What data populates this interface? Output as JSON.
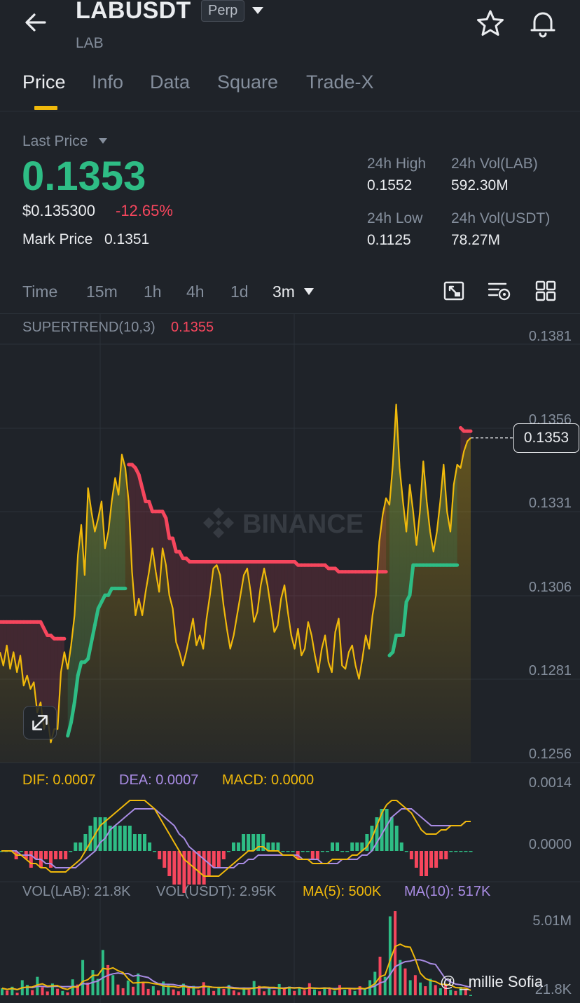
{
  "header": {
    "symbol": "LABUSDT",
    "contract_type": "Perp",
    "base_asset": "LAB",
    "icons": [
      "back-arrow-icon",
      "chevron-down-icon",
      "star-icon",
      "bell-icon"
    ]
  },
  "tabs": [
    {
      "label": "Price",
      "active": true
    },
    {
      "label": "Info",
      "active": false
    },
    {
      "label": "Data",
      "active": false
    },
    {
      "label": "Square",
      "active": false
    },
    {
      "label": "Trade-X",
      "active": false
    }
  ],
  "price": {
    "last_label": "Last Price",
    "last": "0.1353",
    "usd": "$0.135300",
    "change": "-12.65%",
    "mark_label": "Mark Price",
    "mark": "0.1351"
  },
  "stats": {
    "high_label": "24h High",
    "high": "0.1552",
    "vol_base_label": "24h Vol(LAB)",
    "vol_base": "592.30M",
    "low_label": "24h Low",
    "low": "0.1125",
    "vol_quote_label": "24h Vol(USDT)",
    "vol_quote": "78.27M"
  },
  "intervals": [
    {
      "label": "Time",
      "active": false
    },
    {
      "label": "15m",
      "active": false
    },
    {
      "label": "1h",
      "active": false
    },
    {
      "label": "4h",
      "active": false
    },
    {
      "label": "1d",
      "active": false
    },
    {
      "label": "3m",
      "active": true
    }
  ],
  "colors": {
    "up": "#2ebd85",
    "down": "#f6465d",
    "accent": "#f0b90b",
    "ma10": "#a98ce4",
    "background": "#1f2329"
  },
  "chart_data": [
    {
      "type": "line",
      "indicator_label": "SUPERTREND(10,3)",
      "indicator_value": "0.1355",
      "y_ticks": [
        "0.1381",
        "0.1356",
        "0.1331",
        "0.1306",
        "0.1281",
        "0.1256"
      ],
      "ylim": [
        0.1256,
        0.1381
      ],
      "current_price": "0.1353",
      "watermark": "BINANCE",
      "grid": true,
      "price": [
        0.1289,
        0.1285,
        0.1291,
        0.1284,
        0.1289,
        0.1283,
        0.1288,
        0.1279,
        0.1282,
        0.1278,
        0.128,
        0.1271,
        0.1274,
        0.1266,
        0.127,
        0.1262,
        0.1266,
        0.1266,
        0.1283,
        0.1289,
        0.1284,
        0.1291,
        0.13,
        0.1318,
        0.1327,
        0.1312,
        0.1338,
        0.1331,
        0.1325,
        0.1329,
        0.1334,
        0.132,
        0.1325,
        0.1334,
        0.1341,
        0.1336,
        0.1348,
        0.1344,
        0.1334,
        0.1313,
        0.13,
        0.1305,
        0.13,
        0.1307,
        0.1313,
        0.132,
        0.1313,
        0.1307,
        0.132,
        0.1315,
        0.1306,
        0.1302,
        0.1292,
        0.1289,
        0.1285,
        0.1289,
        0.1294,
        0.1299,
        0.1291,
        0.1294,
        0.129,
        0.1299,
        0.1306,
        0.1314,
        0.1315,
        0.1312,
        0.1303,
        0.1296,
        0.129,
        0.1294,
        0.13,
        0.1306,
        0.1312,
        0.1314,
        0.1307,
        0.1298,
        0.1301,
        0.1309,
        0.1314,
        0.1309,
        0.1302,
        0.1295,
        0.1297,
        0.1305,
        0.1309,
        0.1301,
        0.1294,
        0.129,
        0.1296,
        0.1288,
        0.129,
        0.1298,
        0.1294,
        0.1288,
        0.1283,
        0.129,
        0.1294,
        0.1286,
        0.1283,
        0.1295,
        0.1299,
        0.1285,
        0.1284,
        0.1289,
        0.1291,
        0.1285,
        0.1281,
        0.1287,
        0.1294,
        0.129,
        0.13,
        0.1306,
        0.1322,
        0.133,
        0.1335,
        0.1333,
        0.1345,
        0.1363,
        0.1344,
        0.1334,
        0.1325,
        0.1339,
        0.1331,
        0.1321,
        0.1331,
        0.1346,
        0.1334,
        0.1325,
        0.1319,
        0.1325,
        0.1334,
        0.1345,
        0.1331,
        0.1325,
        0.1339,
        0.1345,
        0.1344,
        0.1349,
        0.1352,
        0.1353
      ],
      "supertrend": [
        0.1298,
        0.1298,
        0.1298,
        0.1298,
        0.1298,
        0.1298,
        0.1298,
        0.1298,
        0.1298,
        0.1298,
        0.1298,
        0.1298,
        0.1298,
        0.1296,
        0.1294,
        0.1294,
        0.1293,
        0.1293,
        0.1293,
        0.1293,
        0.1264,
        0.1268,
        0.1274,
        0.1282,
        0.1286,
        0.1286,
        0.1287,
        0.1292,
        0.1297,
        0.1302,
        0.1304,
        0.1306,
        0.1306,
        0.1308,
        0.1308,
        0.1308,
        0.1308,
        0.1308,
        0.1345,
        0.1345,
        0.1344,
        0.1342,
        0.1338,
        0.1334,
        0.1334,
        0.1331,
        0.1331,
        0.1331,
        0.1331,
        0.1329,
        0.1323,
        0.1323,
        0.1319,
        0.1319,
        0.1317,
        0.1317,
        0.1316,
        0.1316,
        0.1316,
        0.1316,
        0.1316,
        0.1316,
        0.1316,
        0.1316,
        0.1316,
        0.1316,
        0.1316,
        0.1316,
        0.1316,
        0.1316,
        0.1316,
        0.1316,
        0.1316,
        0.1316,
        0.1316,
        0.1316,
        0.1316,
        0.1316,
        0.1316,
        0.1316,
        0.1316,
        0.1316,
        0.1316,
        0.1316,
        0.1316,
        0.1316,
        0.1316,
        0.1316,
        0.1315,
        0.1315,
        0.1315,
        0.1315,
        0.1315,
        0.1315,
        0.1315,
        0.1315,
        0.1315,
        0.1314,
        0.1314,
        0.1314,
        0.1313,
        0.1313,
        0.1313,
        0.1313,
        0.1313,
        0.1313,
        0.1313,
        0.1313,
        0.1313,
        0.1313,
        0.1313,
        0.1313,
        0.1313,
        0.1313,
        0.1313,
        0.1288,
        0.1289,
        0.1294,
        0.1294,
        0.1294,
        0.1304,
        0.1306,
        0.1315,
        0.1315,
        0.1315,
        0.1315,
        0.1315,
        0.1315,
        0.1315,
        0.1315,
        0.1315,
        0.1315,
        0.1315,
        0.1315,
        0.1315,
        0.1315,
        0.1356,
        0.1355,
        0.1355,
        0.1355,
        0.1355
      ],
      "supertrend_trend": [
        "down",
        "down",
        "down",
        "down",
        "down",
        "down",
        "down",
        "down",
        "down",
        "down",
        "down",
        "down",
        "down",
        "down",
        "down",
        "down",
        "down",
        "down",
        "down",
        "down",
        "up",
        "up",
        "up",
        "up",
        "up",
        "up",
        "up",
        "up",
        "up",
        "up",
        "up",
        "up",
        "up",
        "up",
        "up",
        "up",
        "up",
        "up",
        "down",
        "down",
        "down",
        "down",
        "down",
        "down",
        "down",
        "down",
        "down",
        "down",
        "down",
        "down",
        "down",
        "down",
        "down",
        "down",
        "down",
        "down",
        "down",
        "down",
        "down",
        "down",
        "down",
        "down",
        "down",
        "down",
        "down",
        "down",
        "down",
        "down",
        "down",
        "down",
        "down",
        "down",
        "down",
        "down",
        "down",
        "down",
        "down",
        "down",
        "down",
        "down",
        "down",
        "down",
        "down",
        "down",
        "down",
        "down",
        "down",
        "down",
        "down",
        "down",
        "down",
        "down",
        "down",
        "down",
        "down",
        "down",
        "down",
        "down",
        "down",
        "down",
        "down",
        "down",
        "down",
        "down",
        "down",
        "down",
        "down",
        "down",
        "down",
        "down",
        "down",
        "down",
        "down",
        "down",
        "down",
        "up",
        "up",
        "up",
        "up",
        "up",
        "up",
        "up",
        "up",
        "up",
        "up",
        "up",
        "up",
        "up",
        "up",
        "up",
        "up",
        "up",
        "up",
        "up",
        "up",
        "up",
        "down",
        "down",
        "down",
        "down",
        "down"
      ]
    },
    {
      "type": "bar",
      "indicator": "MACD",
      "dif_label": "DIF: 0.0007",
      "dea_label": "DEA: 0.0007",
      "macd_label": "MACD: 0.0000",
      "y_ticks": [
        "0.0014",
        "0.0000"
      ],
      "ylim": [
        -0.0008,
        0.0016
      ],
      "dif": [
        0.0,
        0.0,
        0.0,
        -0.0001,
        -0.0001,
        -0.0002,
        -0.0003,
        -0.0003,
        -0.0004,
        -0.0004,
        -0.0005,
        -0.0005,
        -0.0005,
        -0.0005,
        -0.0004,
        -0.0003,
        -0.0002,
        0.0,
        0.0002,
        0.0004,
        0.0006,
        0.0007,
        0.0008,
        0.0009,
        0.001,
        0.0011,
        0.0012,
        0.0012,
        0.0012,
        0.0012,
        0.0011,
        0.001,
        0.0008,
        0.0006,
        0.0004,
        0.0002,
        0.0,
        -0.0002,
        -0.0003,
        -0.0004,
        -0.0005,
        -0.0006,
        -0.0006,
        -0.0006,
        -0.0006,
        -0.0005,
        -0.0004,
        -0.0003,
        -0.0002,
        -0.0001,
        0.0,
        0.0,
        0.0001,
        0.0001,
        0.0,
        0.0,
        0.0,
        -0.0001,
        -0.0001,
        -0.0001,
        -0.0002,
        -0.0002,
        -0.0002,
        -0.0003,
        -0.0003,
        -0.0003,
        -0.0003,
        -0.0002,
        -0.0002,
        -0.0002,
        -0.0002,
        -0.0001,
        -0.0001,
        0.0,
        0.0001,
        0.0003,
        0.0006,
        0.0009,
        0.0011,
        0.0012,
        0.0012,
        0.0011,
        0.001,
        0.0009,
        0.0007,
        0.0005,
        0.0004,
        0.0004,
        0.0004,
        0.0005,
        0.0005,
        0.0006,
        0.0006,
        0.0006,
        0.0007,
        0.0007
      ],
      "dea": [
        0.0,
        0.0,
        0.0,
        0.0,
        -0.0001,
        -0.0001,
        -0.0001,
        -0.0002,
        -0.0002,
        -0.0003,
        -0.0003,
        -0.0004,
        -0.0004,
        -0.0004,
        -0.0004,
        -0.0004,
        -0.0003,
        -0.0002,
        -0.0001,
        0.0,
        0.0002,
        0.0003,
        0.0005,
        0.0006,
        0.0007,
        0.0008,
        0.0009,
        0.001,
        0.001,
        0.001,
        0.001,
        0.001,
        0.0009,
        0.0008,
        0.0007,
        0.0006,
        0.0004,
        0.0003,
        0.0001,
        0.0,
        -0.0001,
        -0.0002,
        -0.0003,
        -0.0004,
        -0.0004,
        -0.0004,
        -0.0004,
        -0.0004,
        -0.0003,
        -0.0003,
        -0.0002,
        -0.0002,
        -0.0001,
        -0.0001,
        -0.0001,
        -0.0001,
        -0.0001,
        -0.0001,
        -0.0001,
        -0.0001,
        -0.0001,
        -0.0002,
        -0.0002,
        -0.0002,
        -0.0002,
        -0.0003,
        -0.0003,
        -0.0003,
        -0.0003,
        -0.0002,
        -0.0002,
        -0.0002,
        -0.0002,
        -0.0001,
        -0.0001,
        0.0,
        0.0002,
        0.0004,
        0.0006,
        0.0008,
        0.0009,
        0.001,
        0.001,
        0.001,
        0.0009,
        0.0008,
        0.0007,
        0.0006,
        0.0006,
        0.0006,
        0.0006,
        0.0006,
        0.0006,
        0.0006,
        0.0007,
        0.0007
      ]
    },
    {
      "type": "bar",
      "indicator": "Volume",
      "vol_base_label": "VOL(LAB): 21.8K",
      "vol_quote_label": "VOL(USDT): 2.95K",
      "ma5_label": "MA(5): 500K",
      "ma10_label": "MA(10): 517K",
      "y_ticks": [
        "5.01M",
        "21.8K"
      ],
      "ylim": [
        0,
        5010000
      ],
      "volume": [
        420000,
        280000,
        510000,
        150000,
        900000,
        620000,
        310000,
        1100000,
        480000,
        230000,
        700000,
        390000,
        260000,
        180000,
        950000,
        640000,
        2100000,
        760000,
        1500000,
        980000,
        2700000,
        1800000,
        1200000,
        640000,
        420000,
        880000,
        510000,
        1300000,
        760000,
        380000,
        540000,
        290000,
        820000,
        610000,
        350000,
        240000,
        690000,
        410000,
        560000,
        320000,
        780000,
        450000,
        260000,
        510000,
        380000,
        620000,
        290000,
        180000,
        470000,
        330000,
        850000,
        560000,
        240000,
        410000,
        300000,
        670000,
        380000,
        520000,
        260000,
        440000,
        310000,
        720000,
        350000,
        240000,
        480000,
        390000,
        270000,
        610000,
        330000,
        420000,
        260000,
        540000,
        380000,
        900000,
        1400000,
        2300000,
        1100000,
        4700000,
        5010000,
        2100000,
        1600000,
        900000,
        1200000,
        760000,
        540000,
        980000,
        610000,
        420000,
        680000,
        330000,
        260000,
        500000,
        380000,
        21800
      ],
      "volume_up": [
        true,
        false,
        true,
        false,
        true,
        true,
        false,
        true,
        false,
        false,
        true,
        false,
        true,
        false,
        true,
        false,
        true,
        false,
        true,
        true,
        true,
        false,
        true,
        false,
        false,
        true,
        false,
        true,
        false,
        false,
        true,
        false,
        true,
        true,
        false,
        false,
        true,
        false,
        true,
        false,
        false,
        true,
        false,
        true,
        false,
        true,
        false,
        false,
        true,
        false,
        true,
        false,
        false,
        true,
        false,
        true,
        false,
        true,
        false,
        true,
        false,
        false,
        true,
        false,
        true,
        false,
        true,
        false,
        true,
        false,
        true,
        false,
        true,
        true,
        true,
        false,
        true,
        true,
        false,
        true,
        false,
        true,
        false,
        true,
        false,
        true,
        false,
        true,
        false,
        true,
        false,
        true,
        false,
        true
      ]
    }
  ],
  "indicator_colors": {
    "dif": "#f0b90b",
    "dea": "#a98ce4",
    "macd": "#f0b90b"
  },
  "watermark_credit": "@ _millie Sofia"
}
